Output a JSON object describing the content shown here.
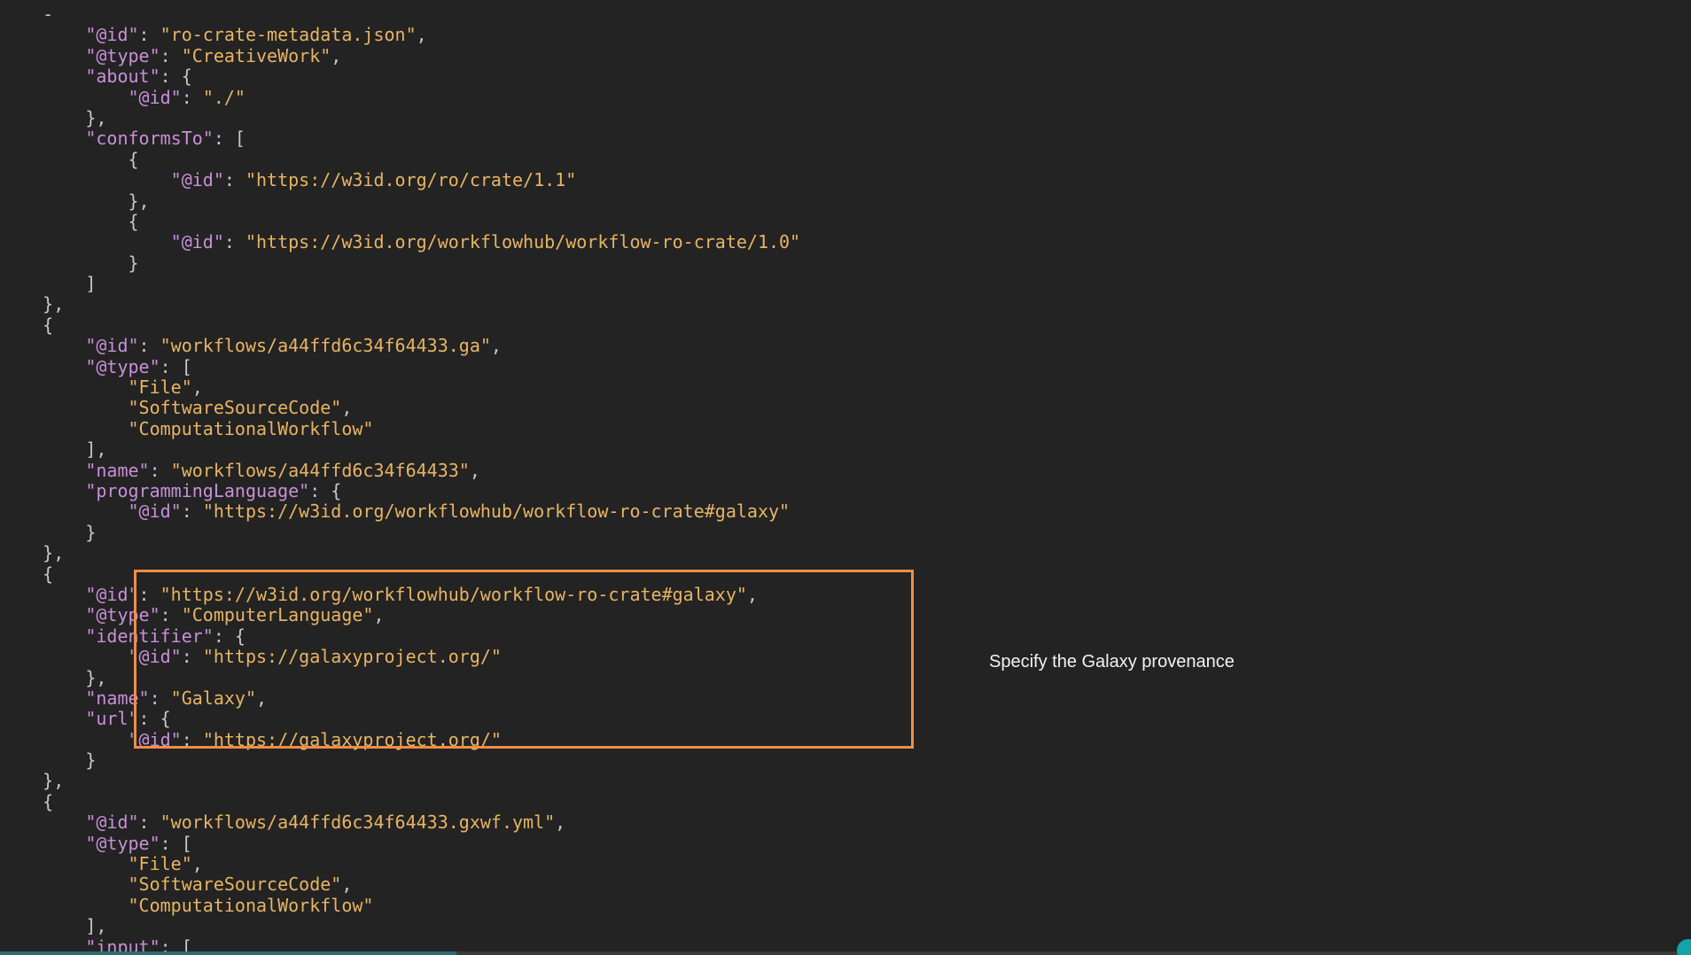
{
  "code": {
    "lines": [
      [
        {
          "t": "    ",
          "c": "p"
        },
        {
          "t": "-",
          "c": "p"
        }
      ],
      [
        {
          "t": "        ",
          "c": "p"
        },
        {
          "t": "\"@id\"",
          "c": "k"
        },
        {
          "t": ": ",
          "c": "p"
        },
        {
          "t": "\"ro-crate-metadata.json\"",
          "c": "s"
        },
        {
          "t": ",",
          "c": "p"
        }
      ],
      [
        {
          "t": "        ",
          "c": "p"
        },
        {
          "t": "\"@type\"",
          "c": "k"
        },
        {
          "t": ": ",
          "c": "p"
        },
        {
          "t": "\"CreativeWork\"",
          "c": "s"
        },
        {
          "t": ",",
          "c": "p"
        }
      ],
      [
        {
          "t": "        ",
          "c": "p"
        },
        {
          "t": "\"about\"",
          "c": "k"
        },
        {
          "t": ": {",
          "c": "p"
        }
      ],
      [
        {
          "t": "            ",
          "c": "p"
        },
        {
          "t": "\"@id\"",
          "c": "k"
        },
        {
          "t": ": ",
          "c": "p"
        },
        {
          "t": "\"./\"",
          "c": "s"
        }
      ],
      [
        {
          "t": "        },",
          "c": "p"
        }
      ],
      [
        {
          "t": "        ",
          "c": "p"
        },
        {
          "t": "\"conformsTo\"",
          "c": "k"
        },
        {
          "t": ": [",
          "c": "p"
        }
      ],
      [
        {
          "t": "            {",
          "c": "p"
        }
      ],
      [
        {
          "t": "                ",
          "c": "p"
        },
        {
          "t": "\"@id\"",
          "c": "k"
        },
        {
          "t": ": ",
          "c": "p"
        },
        {
          "t": "\"https://w3id.org/ro/crate/1.1\"",
          "c": "s"
        }
      ],
      [
        {
          "t": "            },",
          "c": "p"
        }
      ],
      [
        {
          "t": "            {",
          "c": "p"
        }
      ],
      [
        {
          "t": "                ",
          "c": "p"
        },
        {
          "t": "\"@id\"",
          "c": "k"
        },
        {
          "t": ": ",
          "c": "p"
        },
        {
          "t": "\"https://w3id.org/workflowhub/workflow-ro-crate/1.0\"",
          "c": "s"
        }
      ],
      [
        {
          "t": "            }",
          "c": "p"
        }
      ],
      [
        {
          "t": "        ]",
          "c": "p"
        }
      ],
      [
        {
          "t": "    },",
          "c": "p"
        }
      ],
      [
        {
          "t": "    {",
          "c": "p"
        }
      ],
      [
        {
          "t": "        ",
          "c": "p"
        },
        {
          "t": "\"@id\"",
          "c": "k"
        },
        {
          "t": ": ",
          "c": "p"
        },
        {
          "t": "\"workflows/a44ffd6c34f64433.ga\"",
          "c": "s"
        },
        {
          "t": ",",
          "c": "p"
        }
      ],
      [
        {
          "t": "        ",
          "c": "p"
        },
        {
          "t": "\"@type\"",
          "c": "k"
        },
        {
          "t": ": [",
          "c": "p"
        }
      ],
      [
        {
          "t": "            ",
          "c": "p"
        },
        {
          "t": "\"File\"",
          "c": "s"
        },
        {
          "t": ",",
          "c": "p"
        }
      ],
      [
        {
          "t": "            ",
          "c": "p"
        },
        {
          "t": "\"SoftwareSourceCode\"",
          "c": "s"
        },
        {
          "t": ",",
          "c": "p"
        }
      ],
      [
        {
          "t": "            ",
          "c": "p"
        },
        {
          "t": "\"ComputationalWorkflow\"",
          "c": "s"
        }
      ],
      [
        {
          "t": "        ],",
          "c": "p"
        }
      ],
      [
        {
          "t": "        ",
          "c": "p"
        },
        {
          "t": "\"name\"",
          "c": "k"
        },
        {
          "t": ": ",
          "c": "p"
        },
        {
          "t": "\"workflows/a44ffd6c34f64433\"",
          "c": "s"
        },
        {
          "t": ",",
          "c": "p"
        }
      ],
      [
        {
          "t": "        ",
          "c": "p"
        },
        {
          "t": "\"programmingLanguage\"",
          "c": "k"
        },
        {
          "t": ": {",
          "c": "p"
        }
      ],
      [
        {
          "t": "            ",
          "c": "p"
        },
        {
          "t": "\"@id\"",
          "c": "k"
        },
        {
          "t": ": ",
          "c": "p"
        },
        {
          "t": "\"https://w3id.org/workflowhub/workflow-ro-crate#galaxy\"",
          "c": "s"
        }
      ],
      [
        {
          "t": "        }",
          "c": "p"
        }
      ],
      [
        {
          "t": "    },",
          "c": "p"
        }
      ],
      [
        {
          "t": "    {",
          "c": "p"
        }
      ],
      [
        {
          "t": "        ",
          "c": "p"
        },
        {
          "t": "\"@id\"",
          "c": "k"
        },
        {
          "t": ": ",
          "c": "p"
        },
        {
          "t": "\"https://w3id.org/workflowhub/workflow-ro-crate#galaxy\"",
          "c": "s"
        },
        {
          "t": ",",
          "c": "p"
        }
      ],
      [
        {
          "t": "        ",
          "c": "p"
        },
        {
          "t": "\"@type\"",
          "c": "k"
        },
        {
          "t": ": ",
          "c": "p"
        },
        {
          "t": "\"ComputerLanguage\"",
          "c": "s"
        },
        {
          "t": ",",
          "c": "p"
        }
      ],
      [
        {
          "t": "        ",
          "c": "p"
        },
        {
          "t": "\"identifier\"",
          "c": "k"
        },
        {
          "t": ": {",
          "c": "p"
        }
      ],
      [
        {
          "t": "            ",
          "c": "p"
        },
        {
          "t": "\"@id\"",
          "c": "k"
        },
        {
          "t": ": ",
          "c": "p"
        },
        {
          "t": "\"https://galaxyproject.org/\"",
          "c": "s"
        }
      ],
      [
        {
          "t": "        },",
          "c": "p"
        }
      ],
      [
        {
          "t": "        ",
          "c": "p"
        },
        {
          "t": "\"name\"",
          "c": "k"
        },
        {
          "t": ": ",
          "c": "p"
        },
        {
          "t": "\"Galaxy\"",
          "c": "s"
        },
        {
          "t": ",",
          "c": "p"
        }
      ],
      [
        {
          "t": "        ",
          "c": "p"
        },
        {
          "t": "\"url\"",
          "c": "k"
        },
        {
          "t": ": {",
          "c": "p"
        }
      ],
      [
        {
          "t": "            ",
          "c": "p"
        },
        {
          "t": "\"@id\"",
          "c": "k"
        },
        {
          "t": ": ",
          "c": "p"
        },
        {
          "t": "\"https://galaxyproject.org/\"",
          "c": "s"
        }
      ],
      [
        {
          "t": "        }",
          "c": "p"
        }
      ],
      [
        {
          "t": "    },",
          "c": "p"
        }
      ],
      [
        {
          "t": "    {",
          "c": "p"
        }
      ],
      [
        {
          "t": "        ",
          "c": "p"
        },
        {
          "t": "\"@id\"",
          "c": "k"
        },
        {
          "t": ": ",
          "c": "p"
        },
        {
          "t": "\"workflows/a44ffd6c34f64433.gxwf.yml\"",
          "c": "s"
        },
        {
          "t": ",",
          "c": "p"
        }
      ],
      [
        {
          "t": "        ",
          "c": "p"
        },
        {
          "t": "\"@type\"",
          "c": "k"
        },
        {
          "t": ": [",
          "c": "p"
        }
      ],
      [
        {
          "t": "            ",
          "c": "p"
        },
        {
          "t": "\"File\"",
          "c": "s"
        },
        {
          "t": ",",
          "c": "p"
        }
      ],
      [
        {
          "t": "            ",
          "c": "p"
        },
        {
          "t": "\"SoftwareSourceCode\"",
          "c": "s"
        },
        {
          "t": ",",
          "c": "p"
        }
      ],
      [
        {
          "t": "            ",
          "c": "p"
        },
        {
          "t": "\"ComputationalWorkflow\"",
          "c": "s"
        }
      ],
      [
        {
          "t": "        ],",
          "c": "p"
        }
      ],
      [
        {
          "t": "        ",
          "c": "p"
        },
        {
          "t": "\"input\"",
          "c": "k"
        },
        {
          "t": ": [",
          "c": "p"
        }
      ],
      [
        {
          "t": "            {",
          "c": "p"
        }
      ]
    ]
  },
  "annotation": {
    "text": "Specify the Galaxy provenance"
  },
  "player": {
    "played_fraction": 0.0,
    "buffered_fraction": 0.27
  },
  "colors": {
    "background": "#232323",
    "json_key": "#c890d8",
    "json_string": "#e8b463",
    "punctuation": "#c7c7c7",
    "highlight_border": "#ef8d44",
    "annotation_text": "#f2f2f2",
    "progress_accent": "#14a3a8"
  }
}
